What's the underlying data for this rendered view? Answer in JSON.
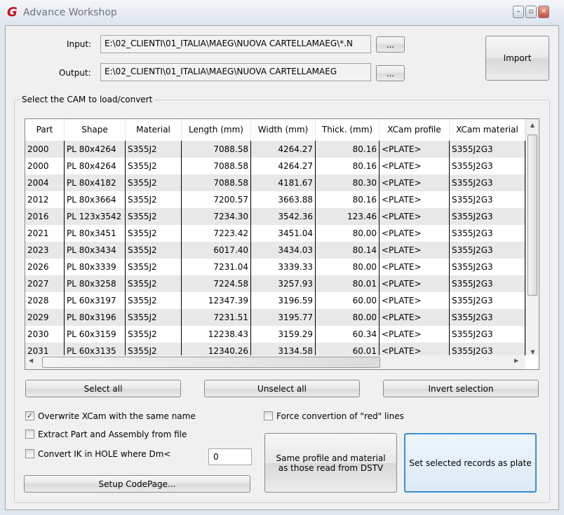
{
  "window": {
    "title": "Advance Workshop",
    "logo": "G"
  },
  "input": {
    "label": "Input:",
    "value": "E:\\02_CLIENTI\\01_ITALIA\\MAEG\\NUOVA CARTELLAMAEG\\*.N",
    "browse": "..."
  },
  "output": {
    "label": "Output:",
    "value": "E:\\02_CLIENTI\\01_ITALIA\\MAEG\\NUOVA CARTELLAMAEG",
    "browse": "..."
  },
  "import_label": "Import",
  "group_label": "Select the CAM to load/convert",
  "table": {
    "columns": [
      "Part",
      "Shape",
      "Material",
      "Length (mm)",
      "Width (mm)",
      "Thick. (mm)",
      "XCam profile",
      "XCam material"
    ],
    "rows": [
      [
        "2000",
        "PL 80x4264",
        "S355J2",
        "7088.58",
        "4264.27",
        "80.16",
        "<PLATE>",
        "S355J2G3"
      ],
      [
        "2000",
        "PL 80x4264",
        "S355J2",
        "7088.58",
        "4264.27",
        "80.16",
        "<PLATE>",
        "S355J2G3"
      ],
      [
        "2004",
        "PL 80x4182",
        "S355J2",
        "7088.58",
        "4181.67",
        "80.30",
        "<PLATE>",
        "S355J2G3"
      ],
      [
        "2012",
        "PL 80x3664",
        "S355J2",
        "7200.57",
        "3663.88",
        "80.16",
        "<PLATE>",
        "S355J2G3"
      ],
      [
        "2016",
        "PL 123x3542",
        "S355J2",
        "7234.30",
        "3542.36",
        "123.46",
        "<PLATE>",
        "S355J2G3"
      ],
      [
        "2021",
        "PL 80x3451",
        "S355J2",
        "7223.42",
        "3451.04",
        "80.00",
        "<PLATE>",
        "S355J2G3"
      ],
      [
        "2023",
        "PL 80x3434",
        "S355J2",
        "6017.40",
        "3434.03",
        "80.14",
        "<PLATE>",
        "S355J2G3"
      ],
      [
        "2026",
        "PL 80x3339",
        "S355J2",
        "7231.04",
        "3339.33",
        "80.00",
        "<PLATE>",
        "S355J2G3"
      ],
      [
        "2027",
        "PL 80x3258",
        "S355J2",
        "7224.58",
        "3257.93",
        "80.01",
        "<PLATE>",
        "S355J2G3"
      ],
      [
        "2028",
        "PL 60x3197",
        "S355J2",
        "12347.39",
        "3196.59",
        "60.00",
        "<PLATE>",
        "S355J2G3"
      ],
      [
        "2029",
        "PL 80x3196",
        "S355J2",
        "7231.51",
        "3195.77",
        "80.00",
        "<PLATE>",
        "S355J2G3"
      ],
      [
        "2030",
        "PL 60x3159",
        "S355J2",
        "12238.43",
        "3159.29",
        "60.34",
        "<PLATE>",
        "S355J2G3"
      ],
      [
        "2031",
        "PL 60x3135",
        "S355J2",
        "12340.26",
        "3134.58",
        "60.01",
        "<PLATE>",
        "S355J2G3"
      ]
    ]
  },
  "buttons": {
    "select_all": "Select all",
    "unselect_all": "Unselect all",
    "invert": "Invert selection",
    "setup_codepage": "Setup CodePage...",
    "same_profile": "Same profile and material as those read from DSTV",
    "set_plate": "Set selected records as plate"
  },
  "options": {
    "overwrite": {
      "label": "Overwrite XCam with the same name",
      "checked": true
    },
    "extract": {
      "label": "Extract Part and Assembly from file",
      "checked": false
    },
    "convert_ik": {
      "label": "Convert IK in HOLE where Dm<",
      "checked": false,
      "value": "0"
    },
    "force_red": {
      "label": "Force convertion of \"red\" lines",
      "checked": false
    }
  },
  "colors": {
    "accent": "#3c8fd0",
    "logo": "#c0141c",
    "row_alt": "#e8e8e8"
  }
}
